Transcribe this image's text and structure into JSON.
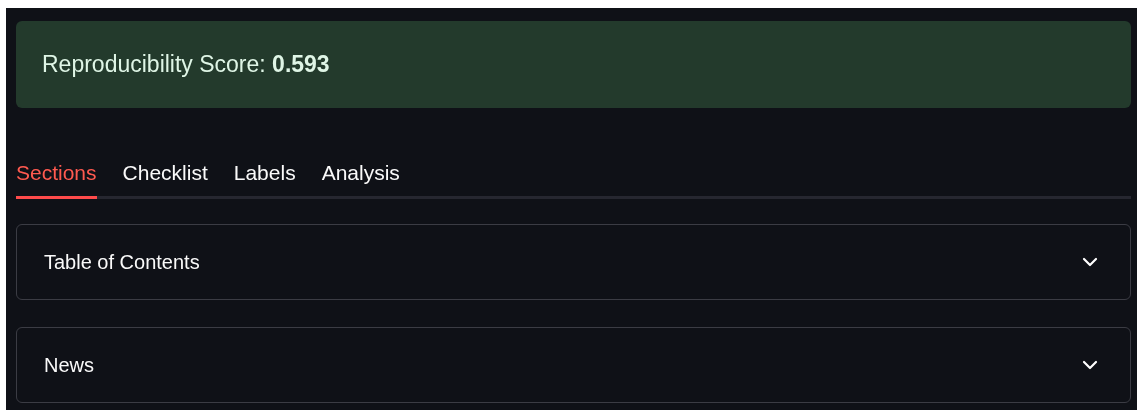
{
  "score_banner": {
    "text": "Reproducibility Score: **0.593**"
  },
  "tabs": [
    {
      "label": "Sections",
      "selected": true
    },
    {
      "label": "Checklist",
      "selected": false
    },
    {
      "label": "Labels",
      "selected": false
    },
    {
      "label": "Analysis",
      "selected": false
    }
  ],
  "sections": [
    {
      "title": "Table of Contents",
      "expanded": false
    },
    {
      "title": "News",
      "expanded": false
    }
  ]
}
